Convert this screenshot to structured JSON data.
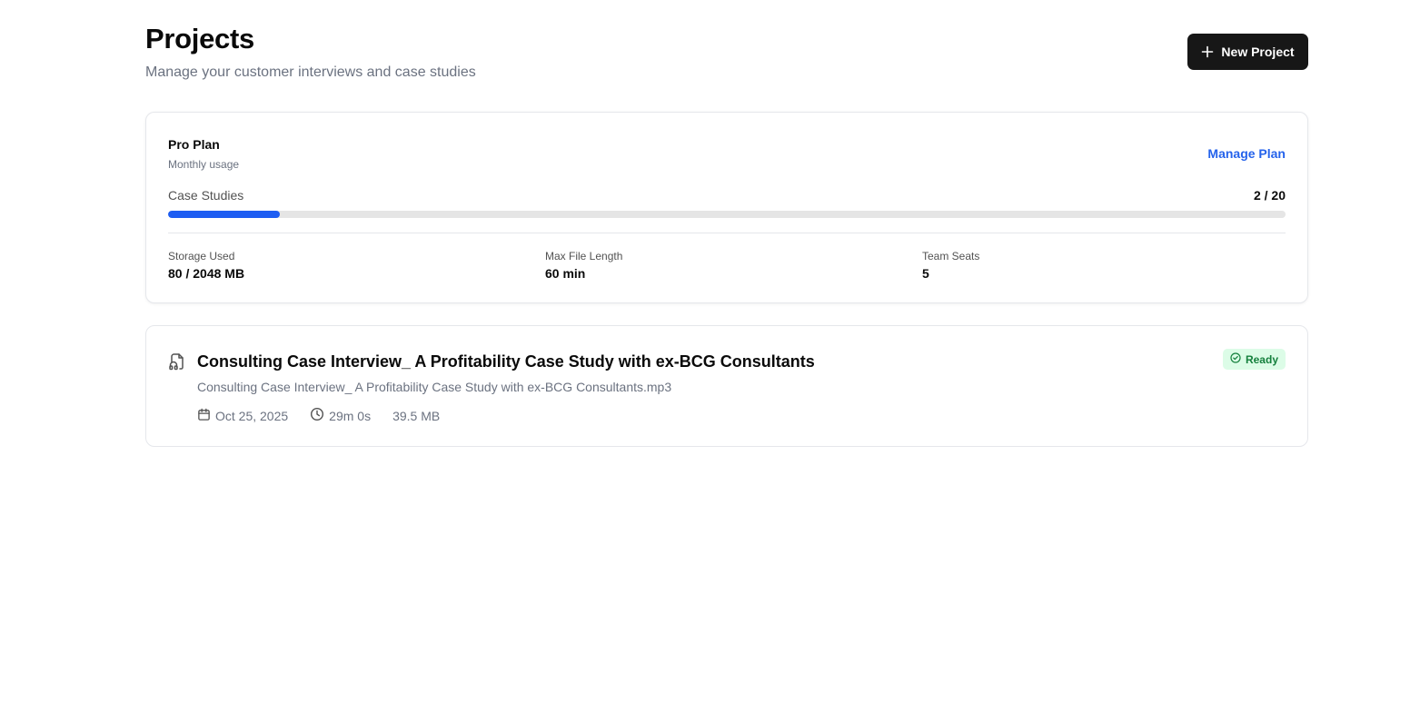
{
  "header": {
    "title": "Projects",
    "subtitle": "Manage your customer interviews and case studies",
    "new_project_label": "New Project",
    "new_project_icon": "plus-icon"
  },
  "plan": {
    "name": "Pro Plan",
    "subtitle": "Monthly usage",
    "manage_label": "Manage Plan",
    "usage": {
      "label": "Case Studies",
      "count_text": "2 / 20",
      "used": 2,
      "limit": 20
    },
    "stats": [
      {
        "label": "Storage Used",
        "value": "80 / 2048 MB"
      },
      {
        "label": "Max File Length",
        "value": "60 min"
      },
      {
        "label": "Team Seats",
        "value": "5"
      }
    ],
    "accent_color": "#1d5df2",
    "link_color": "#2563eb"
  },
  "projects": [
    {
      "icon": "headphones-file-icon",
      "title": "Consulting Case Interview_ A Profitability Case Study with ex-BCG Consultants",
      "file_name": "Consulting Case Interview_ A Profitability Case Study with ex-BCG Consultants.mp3",
      "date": "Oct 25, 2025",
      "duration": "29m 0s",
      "size": "39.5 MB",
      "status": "Ready",
      "status_color": "#15803d"
    }
  ]
}
